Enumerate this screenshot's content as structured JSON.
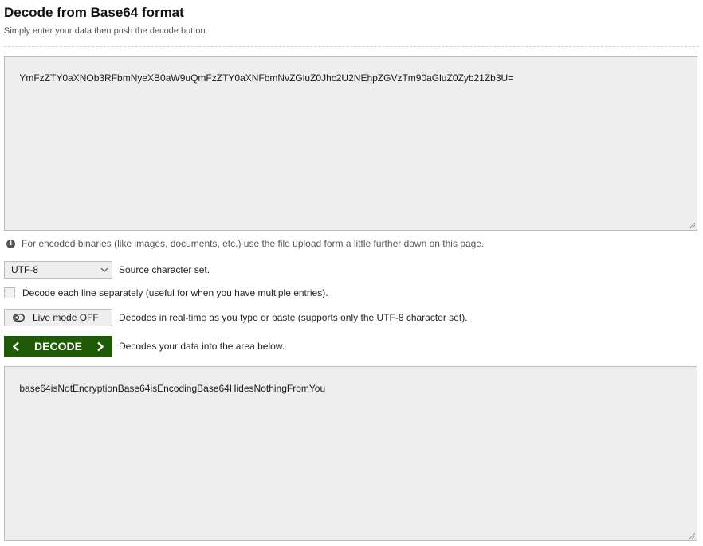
{
  "header": {
    "title": "Decode from Base64 format",
    "subtitle": "Simply enter your data then push the decode button."
  },
  "source": {
    "value": "YmFzZTY0aXNOb3RFbmNyeXB0aW9uQmFzZTY0aXNFbmNvZGluZ0Jhc2U2NEhpZGVzTm90aGluZ0Zyb21Zb3U="
  },
  "hint": {
    "icon": "info-icon",
    "text": "For encoded binaries (like images, documents, etc.) use the file upload form a little further down on this page."
  },
  "charset": {
    "selected": "UTF-8",
    "label": "Source character set."
  },
  "each_line": {
    "checked": false,
    "label": "Decode each line separately (useful for when you have multiple entries)."
  },
  "live_mode": {
    "button_label": "Live mode OFF",
    "description": "Decodes in real-time as you type or paste (supports only the UTF-8 character set)."
  },
  "decode": {
    "button_label": "DECODE",
    "description": "Decodes your data into the area below.",
    "color": "#1f5a06"
  },
  "result": {
    "value": "base64isNotEncryptionBase64isEncodingBase64HidesNothingFromYou"
  }
}
